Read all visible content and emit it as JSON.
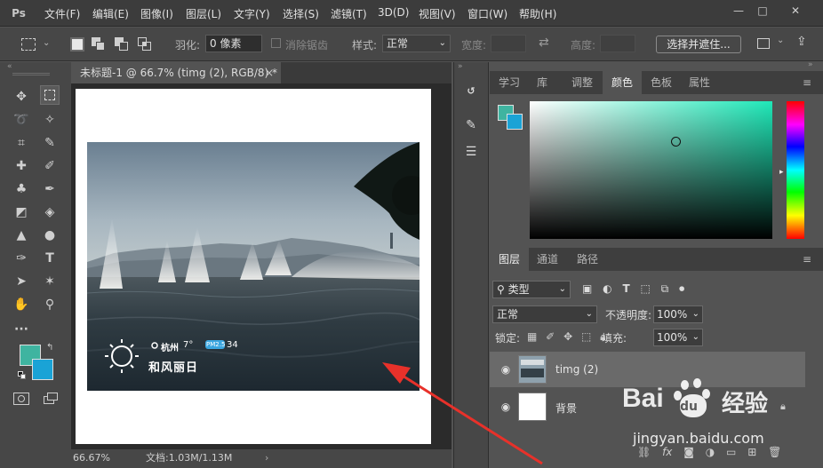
{
  "menubar": {
    "logo": "Ps",
    "items": [
      "文件(F)",
      "编辑(E)",
      "图像(I)",
      "图层(L)",
      "文字(Y)",
      "选择(S)",
      "滤镜(T)",
      "3D(D)",
      "视图(V)",
      "窗口(W)",
      "帮助(H)"
    ],
    "minimize": "—",
    "maximize": "□",
    "close": "✕"
  },
  "options": {
    "feather_label": "羽化:",
    "feather_value": "0 像素",
    "antialias_label": "消除锯齿",
    "style_label": "样式:",
    "style_value": "正常",
    "width_label": "宽度:",
    "height_label": "高度:",
    "select_mask_button": "选择并遮住..."
  },
  "document": {
    "tab_title": "未标题-1 @ 66.7% (timg (2), RGB/8) *",
    "tab_close": "×",
    "zoom": "66.67%",
    "doc_info": "文档:1.03M/1.13M",
    "photo_overlay": {
      "city": "杭州",
      "temp": "7°",
      "aqi_badge": "PM2.5",
      "aqi_value": "34",
      "caption": "和风丽日"
    }
  },
  "top_panel": {
    "tabs": [
      "学习",
      "库",
      "调整",
      "颜色",
      "色板",
      "属性"
    ],
    "active_tab": "颜色"
  },
  "layers_panel": {
    "tabs": [
      "图层",
      "通道",
      "路径"
    ],
    "active_tab": "图层",
    "filter_label": "类型",
    "blend_mode": "正常",
    "opacity_label": "不透明度:",
    "opacity_value": "100%",
    "lock_label": "锁定:",
    "fill_label": "填充:",
    "fill_value": "100%",
    "layers": [
      {
        "name": "timg (2)",
        "selected": true
      },
      {
        "name": "背景",
        "selected": false
      }
    ]
  },
  "colors": {
    "foreground": "#3fb4a0",
    "background": "#1aa3d6",
    "accent": "#3ff0c8"
  },
  "watermark": {
    "brand": "Bai",
    "brand2": "du",
    "brand_cn": "经验",
    "url": "jingyan.baidu.com"
  }
}
